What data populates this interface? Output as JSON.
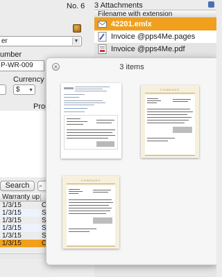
{
  "form": {
    "doc_number_label": "No. 6",
    "select_value": "er",
    "number_label": "umber",
    "number_value": "P-WR-009",
    "currency_label": "Currency",
    "currency_value": "$",
    "products_label": "Prod",
    "search_label": "Search",
    "table": {
      "header": "Warranty up",
      "rows": [
        {
          "date": "1/3/15",
          "c2": "C"
        },
        {
          "date": "1/3/15",
          "c2": "S"
        },
        {
          "date": "1/3/15",
          "c2": "S"
        },
        {
          "date": "1/3/15",
          "c2": "S"
        },
        {
          "date": "1/3/15",
          "c2": "S"
        },
        {
          "date": "1/3/15",
          "c2": "C"
        }
      ],
      "selected_index": 5
    }
  },
  "attachments": {
    "title": "3 Attachments",
    "column_header": "Filename with extension",
    "files": [
      {
        "name": "42201.emlx",
        "icon": "mail-icon"
      },
      {
        "name": "Invoice @pps4Me.pages",
        "icon": "pages-document-icon"
      },
      {
        "name": "Invoice @pps4Me.pdf",
        "icon": "pdf-document-icon"
      }
    ]
  },
  "quicklook": {
    "title": "3 items",
    "thumbnails": [
      {
        "kind": "email-preview"
      },
      {
        "kind": "invoice-preview",
        "header": "COMPANY"
      },
      {
        "kind": "invoice-preview",
        "header": "COMPANY"
      }
    ]
  },
  "colors": {
    "selection": "#f0a01c",
    "row_alt": "#edf3fe"
  }
}
